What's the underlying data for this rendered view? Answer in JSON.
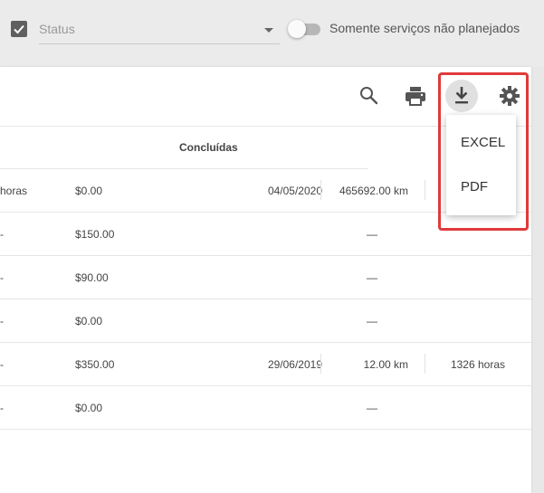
{
  "filters": {
    "status_placeholder": "Status",
    "toggle_label": "Somente serviços não planejados"
  },
  "toolbar": {
    "icons": [
      "search-icon",
      "print-icon",
      "download-icon",
      "gear-icon"
    ]
  },
  "table": {
    "group_header": "Concluídas",
    "rows": [
      {
        "c1": "horas",
        "c2": "$0.00",
        "c3": "04/05/2020",
        "c4": "465692.00 km",
        "c5": ""
      },
      {
        "c1": "-",
        "c2": "$150.00",
        "c3": "",
        "c4": "—",
        "c5": ""
      },
      {
        "c1": "-",
        "c2": "$90.00",
        "c3": "",
        "c4": "—",
        "c5": ""
      },
      {
        "c1": "-",
        "c2": "$0.00",
        "c3": "",
        "c4": "—",
        "c5": ""
      },
      {
        "c1": "-",
        "c2": "$350.00",
        "c3": "29/06/2019",
        "c4": "12.00 km",
        "c5": "1326 horas"
      },
      {
        "c1": "-",
        "c2": "$0.00",
        "c3": "",
        "c4": "—",
        "c5": ""
      }
    ]
  },
  "export_menu": {
    "items": [
      "EXCEL",
      "PDF"
    ]
  },
  "colors": {
    "highlight": "#e03a3a",
    "icon": "#555555"
  }
}
